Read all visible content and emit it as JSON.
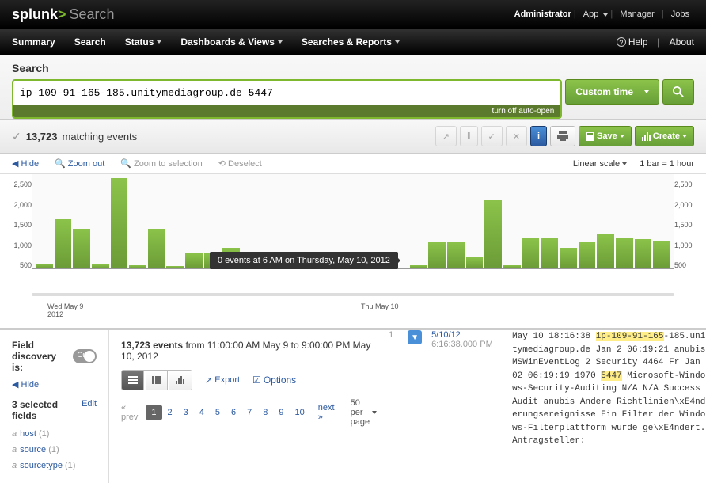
{
  "top": {
    "logo_brand": "splunk",
    "logo_gt": ">",
    "logo_app": "Search",
    "user": "Administrator",
    "links": [
      "App",
      "Manager",
      "Jobs"
    ]
  },
  "nav": {
    "items": [
      "Summary",
      "Search",
      "Status",
      "Dashboards & Views",
      "Searches & Reports"
    ],
    "help": "Help",
    "about": "About"
  },
  "search": {
    "title": "Search",
    "query": "ip-109-91-165-185.unitymediagroup.de 5447",
    "auto_open": "turn off auto-open",
    "time_label": "Custom time"
  },
  "results": {
    "count": "13,723",
    "label": "matching events",
    "save": "Save",
    "create": "Create"
  },
  "timeline": {
    "hide": "Hide",
    "zoom_out": "Zoom out",
    "zoom_sel": "Zoom to selection",
    "deselect": "Deselect",
    "scale": "Linear scale",
    "bar_info": "1 bar = 1 hour",
    "y_ticks": [
      "2,500",
      "2,000",
      "1,500",
      "1,000",
      "500"
    ],
    "ts_start": "May 9, 2012 11:00 AM",
    "ts_end": "May 10, 2012 9:00 PM",
    "x_ticks": [
      "Wed May 9\n2012",
      "Thu May 10"
    ],
    "tooltip": "0 events at 6 AM on Thursday, May 10, 2012"
  },
  "chart_data": {
    "type": "bar",
    "title": "",
    "xlabel": "",
    "ylabel": "",
    "ylim": [
      0,
      2500
    ],
    "x_range": [
      "2012-05-09T11:00",
      "2012-05-10T21:00"
    ],
    "bucket": "1 hour",
    "categories": [
      "11:00",
      "12:00",
      "13:00",
      "14:00",
      "15:00",
      "16:00",
      "17:00",
      "18:00",
      "19:00",
      "20:00",
      "21:00",
      "22:00",
      "23:00",
      "00:00",
      "01:00",
      "02:00",
      "03:00",
      "04:00",
      "05:00",
      "06:00",
      "07:00",
      "08:00",
      "09:00",
      "10:00",
      "11:00",
      "12:00",
      "13:00",
      "14:00",
      "15:00",
      "16:00",
      "17:00",
      "18:00",
      "19:00",
      "20:00"
    ],
    "values": [
      120,
      1300,
      1050,
      100,
      2400,
      80,
      1050,
      60,
      400,
      400,
      550,
      400,
      300,
      120,
      320,
      60,
      0,
      0,
      0,
      0,
      80,
      700,
      700,
      300,
      1800,
      80,
      800,
      800,
      550,
      700,
      900,
      830,
      780,
      720
    ]
  },
  "sidebar": {
    "field_disc": "Field discovery is:",
    "toggle": "On",
    "hide": "Hide",
    "sel_title": "3 selected fields",
    "edit": "Edit",
    "fields": [
      {
        "name": "host",
        "count": "(1)"
      },
      {
        "name": "source",
        "count": "(1)"
      },
      {
        "name": "sourcetype",
        "count": "(1)"
      }
    ]
  },
  "events": {
    "count": "13,723",
    "label": "events",
    "range": "from 11:00:00 AM May 9 to 9:00:00 PM May 10, 2012",
    "export": "Export",
    "options": "Options",
    "prev": "« prev",
    "pages": [
      "1",
      "2",
      "3",
      "4",
      "5",
      "6",
      "7",
      "8",
      "9",
      "10"
    ],
    "next": "next »",
    "perpage": "50 per page"
  },
  "event1": {
    "num": "1",
    "date": "5/10/12",
    "time": "6:16:38.000 PM",
    "p1": "May 10 18:16:38 ",
    "hl1": "ip-109-91-165",
    "p2": "-185.unitymediagroup.de Jan  2 06:19:21 anubis MSWinEventLog   2    Security    4464    Fr Jan 02 06:19:19 1970 ",
    "hl2": "5447",
    "p3": "    Microsoft-Windows-Security-Auditing      N/A    N/A    Success Audit  anubis  Andere Richtlinien\\xE4nderungsereignisse       Ein Filter der Windows-Filterplattform wurde ge\\xE4ndert.   Antragsteller:"
  }
}
